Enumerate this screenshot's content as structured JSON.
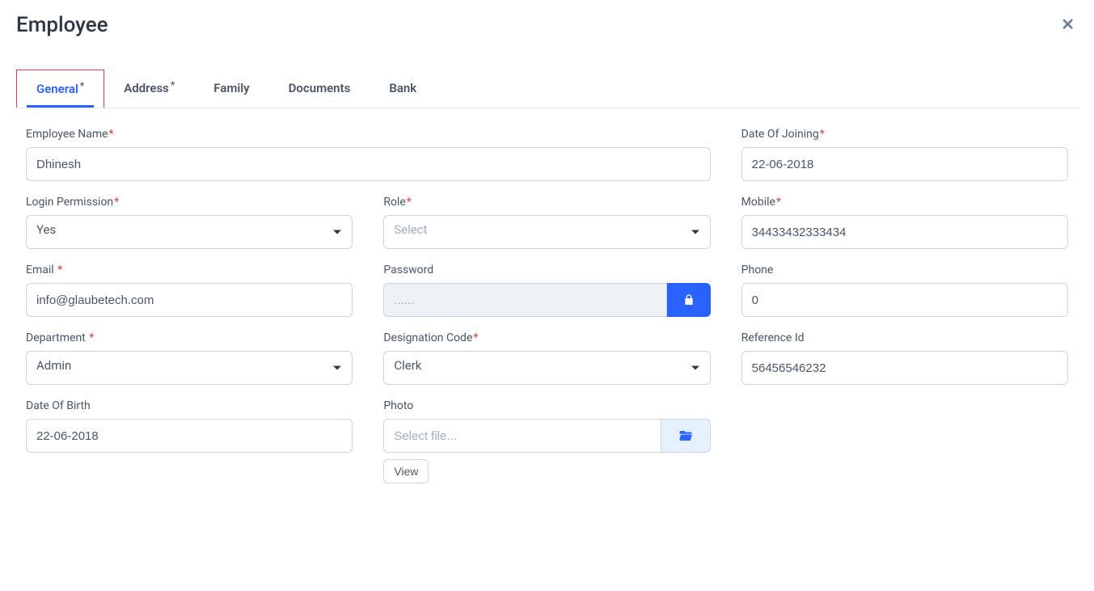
{
  "header": {
    "title": "Employee"
  },
  "tabs": [
    {
      "label": "General",
      "required": true,
      "active": true
    },
    {
      "label": "Address",
      "required": true,
      "active": false
    },
    {
      "label": "Family",
      "required": false,
      "active": false
    },
    {
      "label": "Documents",
      "required": false,
      "active": false
    },
    {
      "label": "Bank",
      "required": false,
      "active": false
    }
  ],
  "form": {
    "employee_name": {
      "label": "Employee Name",
      "value": "Dhinesh"
    },
    "date_of_joining": {
      "label": "Date Of Joining",
      "value": "22-06-2018"
    },
    "login_permission": {
      "label": "Login Permission",
      "value": "Yes"
    },
    "role": {
      "label": "Role",
      "value": "Select"
    },
    "mobile": {
      "label": "Mobile",
      "value": "34433432333434"
    },
    "email": {
      "label": "Email",
      "value": "info@glaubetech.com"
    },
    "password": {
      "label": "Password",
      "placeholder": "......"
    },
    "phone": {
      "label": "Phone",
      "value": "0"
    },
    "department": {
      "label": "Department",
      "value": "Admin"
    },
    "designation_code": {
      "label": "Designation Code",
      "value": "Clerk"
    },
    "reference_id": {
      "label": "Reference Id",
      "value": "56456546232"
    },
    "date_of_birth": {
      "label": "Date Of Birth",
      "value": "22-06-2018"
    },
    "photo": {
      "label": "Photo",
      "placeholder": "Select file...",
      "view_label": "View"
    }
  }
}
